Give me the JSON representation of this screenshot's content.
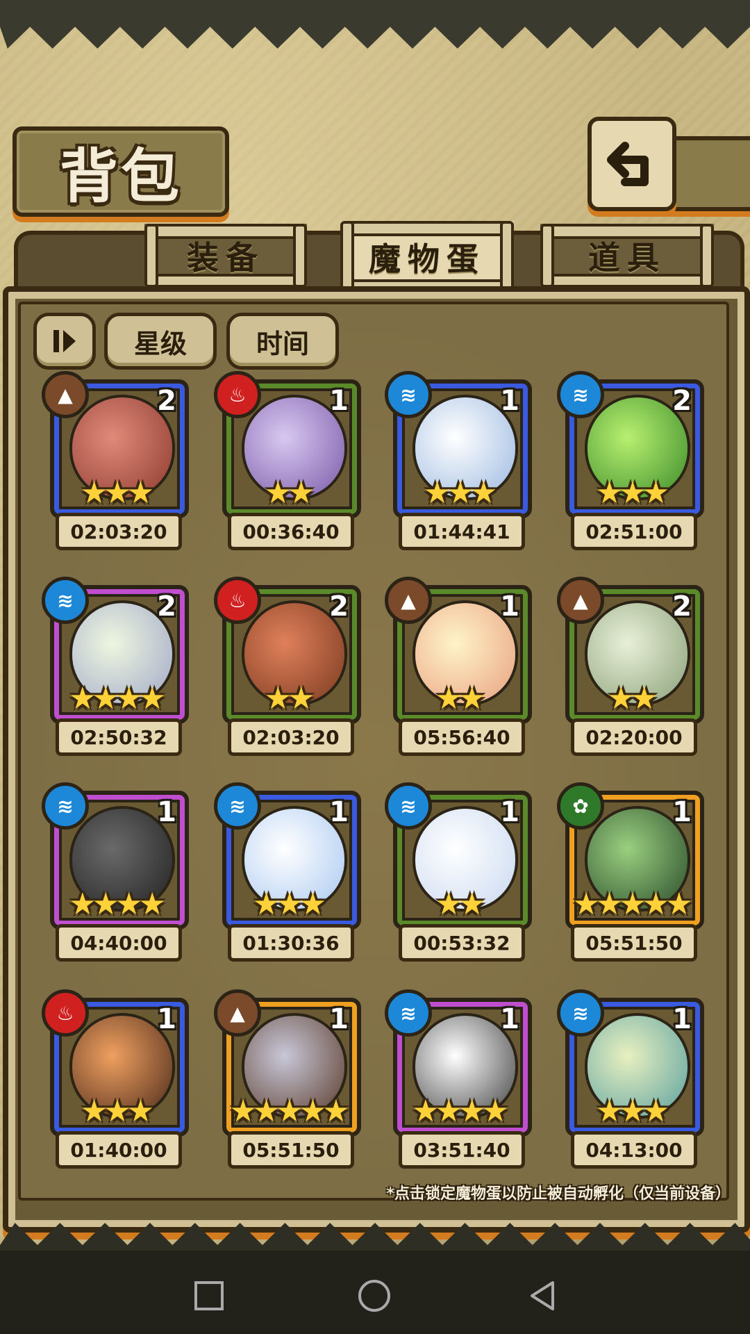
{
  "header": {
    "title": "背包"
  },
  "tabs": [
    {
      "label": "装备",
      "active": false
    },
    {
      "label": "魔物蛋",
      "active": true
    },
    {
      "label": "道具",
      "active": false
    }
  ],
  "sort": {
    "order_icon": "pause-sort-icon",
    "star_label": "星级",
    "time_label": "时间"
  },
  "colors": {
    "rarity_blue": "#3a5ae0",
    "rarity_green": "#5a8a2a",
    "rarity_purple": "#c04fd0",
    "rarity_orange": "#f0a020",
    "elem_earth": "#7a4a2a",
    "elem_fire": "#d02020",
    "elem_water": "#1e88d8",
    "elem_wind": "#2f7a2a"
  },
  "eggs": [
    {
      "element": "earth",
      "rarity": "blue",
      "count": "2",
      "stars": "★★★",
      "time": "02:03:20",
      "art": "pink-cat-hood-egg"
    },
    {
      "element": "fire",
      "rarity": "green",
      "count": "1",
      "stars": "★★",
      "time": "00:36:40",
      "art": "purple-bud-egg"
    },
    {
      "element": "water",
      "rarity": "blue",
      "count": "1",
      "stars": "★★★",
      "time": "01:44:41",
      "art": "cloud-egg"
    },
    {
      "element": "water",
      "rarity": "blue",
      "count": "2",
      "stars": "★★★",
      "time": "02:51:00",
      "art": "green-slime-egg"
    },
    {
      "element": "water",
      "rarity": "purple",
      "count": "2",
      "stars": "★★★★",
      "time": "02:50:32",
      "art": "feather-egg"
    },
    {
      "element": "fire",
      "rarity": "green",
      "count": "2",
      "stars": "★★",
      "time": "02:03:20",
      "art": "fire-pit-egg"
    },
    {
      "element": "earth",
      "rarity": "green",
      "count": "1",
      "stars": "★★",
      "time": "05:56:40",
      "art": "helmet-egg"
    },
    {
      "element": "earth",
      "rarity": "green",
      "count": "2",
      "stars": "★★",
      "time": "02:20:00",
      "art": "ringed-egg"
    },
    {
      "element": "water",
      "rarity": "purple",
      "count": "1",
      "stars": "★★★★",
      "time": "04:40:00",
      "art": "jackal-egg"
    },
    {
      "element": "water",
      "rarity": "blue",
      "count": "1",
      "stars": "★★★",
      "time": "01:30:36",
      "art": "sailor-egg"
    },
    {
      "element": "water",
      "rarity": "green",
      "count": "1",
      "stars": "★★",
      "time": "00:53:32",
      "art": "planet-egg"
    },
    {
      "element": "wind",
      "rarity": "orange",
      "count": "1",
      "stars": "★★★★★",
      "time": "05:51:50",
      "art": "lantern-egg"
    },
    {
      "element": "fire",
      "rarity": "blue",
      "count": "1",
      "stars": "★★★",
      "time": "01:40:00",
      "art": "flame-fur-egg"
    },
    {
      "element": "earth",
      "rarity": "orange",
      "count": "1",
      "stars": "★★★★★",
      "time": "05:51:50",
      "art": "sword-egg"
    },
    {
      "element": "water",
      "rarity": "purple",
      "count": "1",
      "stars": "★★★★",
      "time": "03:51:40",
      "art": "skull-doll-egg"
    },
    {
      "element": "water",
      "rarity": "blue",
      "count": "1",
      "stars": "★★★",
      "time": "04:13:00",
      "art": "striped-egg"
    }
  ],
  "hint": "*点击锁定魔物蛋以防止被自动孵化（仅当前设备）",
  "navbar": {
    "home": "square-icon",
    "circle": "circle-icon",
    "back": "triangle-back-icon"
  }
}
